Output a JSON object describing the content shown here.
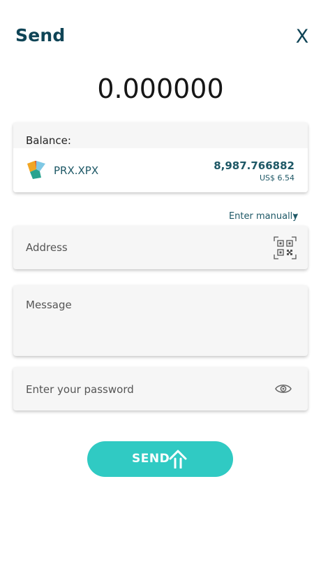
{
  "header": {
    "title": "Send",
    "close_label": "X"
  },
  "amount": "0.000000",
  "balance": {
    "label": "Balance:",
    "token_name": "PRX.XPX",
    "token_amount": "8,987.766882",
    "usd_value": "US$ 6.54"
  },
  "recipient": {
    "enter_manually_label": "Enter manually",
    "address_placeholder": "Address"
  },
  "message": {
    "placeholder": "Message"
  },
  "password": {
    "placeholder": "Enter your password"
  },
  "send_button": {
    "label": "SEND"
  },
  "icons": {
    "close": "close-icon",
    "token": "proximax-logo-icon",
    "dropdown": "caret-down-icon",
    "qr": "qr-code-scan-icon",
    "eye": "eye-icon",
    "send": "arrow-up-icon"
  },
  "colors": {
    "primary_dark": "#0f4456",
    "accent": "#30cac3",
    "card_bg": "#f6f6f6",
    "text_link": "#1e5866"
  }
}
